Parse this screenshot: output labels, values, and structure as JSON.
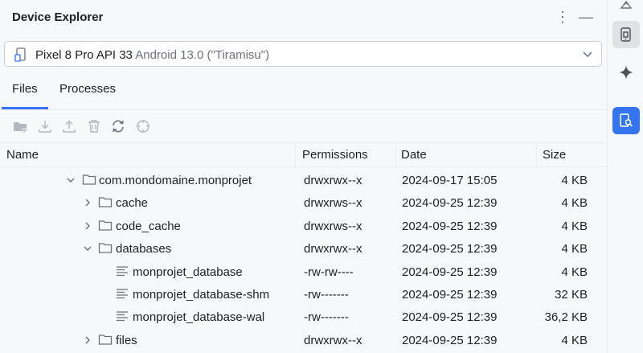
{
  "header": {
    "title": "Device Explorer"
  },
  "device": {
    "name": "Pixel 8 Pro API 33",
    "version": "Android 13.0 (\"Tiramisu\")"
  },
  "tabs": [
    {
      "label": "Files"
    },
    {
      "label": "Processes"
    }
  ],
  "columns": {
    "name": "Name",
    "permissions": "Permissions",
    "date": "Date",
    "size": "Size"
  },
  "rows": [
    {
      "name": "com.mondomaine.monprojet",
      "permissions": "drwxrwx--x",
      "date": "2024-09-17 15:05",
      "size": "4 KB"
    },
    {
      "name": "cache",
      "permissions": "drwxrws--x",
      "date": "2024-09-25 12:39",
      "size": "4 KB"
    },
    {
      "name": "code_cache",
      "permissions": "drwxrws--x",
      "date": "2024-09-25 12:39",
      "size": "4 KB"
    },
    {
      "name": "databases",
      "permissions": "drwxrwx--x",
      "date": "2024-09-25 12:39",
      "size": "4 KB"
    },
    {
      "name": "monprojet_database",
      "permissions": "-rw-rw----",
      "date": "2024-09-25 12:39",
      "size": "4 KB"
    },
    {
      "name": "monprojet_database-shm",
      "permissions": "-rw-------",
      "date": "2024-09-25 12:39",
      "size": "32 KB"
    },
    {
      "name": "monprojet_database-wal",
      "permissions": "-rw-------",
      "date": "2024-09-25 12:39",
      "size": "36,2 KB"
    },
    {
      "name": "files",
      "permissions": "drwxrwx--x",
      "date": "2024-09-25 12:39",
      "size": "4 KB"
    }
  ],
  "icons": {
    "toolbar": [
      "new-folder-icon",
      "download-icon",
      "upload-icon",
      "delete-icon",
      "refresh-icon",
      "sync-target-icon"
    ],
    "sidebar": [
      "sidebar-top-icon",
      "device-manager-icon",
      "gemini-icon",
      "device-explorer-icon"
    ]
  },
  "colors": {
    "accent": "#3574f0",
    "active_tool_bg": "#dfe1e5",
    "disabled_icon": "#b4b8bf"
  }
}
